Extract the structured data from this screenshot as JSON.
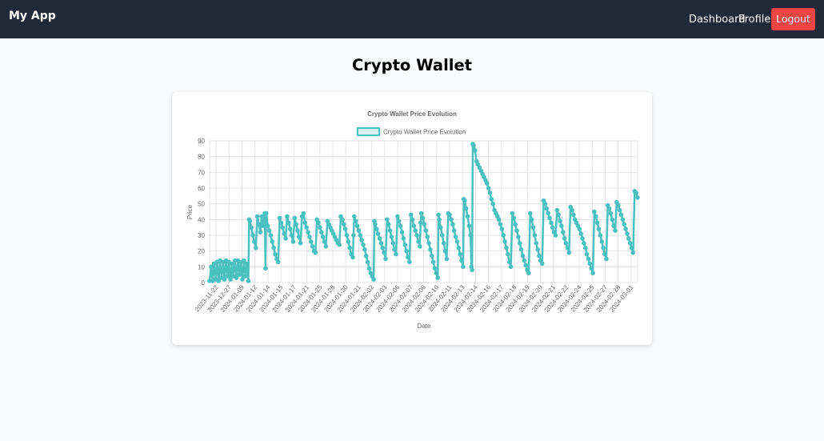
{
  "navbar": {
    "brand": "My App",
    "links": [
      "Dashboard",
      "Profile"
    ],
    "logout_label": "Logout"
  },
  "page": {
    "title": "Crypto Wallet"
  },
  "colors": {
    "navbar_bg": "#1f2937",
    "logout_bg": "#ef4444",
    "series": "#4bc0c0"
  },
  "chart_data": {
    "type": "line",
    "title": "Crypto Wallet Price Evolution",
    "xlabel": "Date",
    "ylabel": "Price",
    "ylim": [
      0,
      90
    ],
    "yticks": [
      0,
      10,
      20,
      30,
      40,
      50,
      60,
      70,
      80,
      90
    ],
    "grid": true,
    "legend": "top",
    "x_tick_labels": [
      "2023-11-22",
      "2023-12-27",
      "2024-01-09",
      "2024-01-12",
      "2024-01-14",
      "2024-01-15",
      "2024-01-17",
      "2024-01-21",
      "2024-01-25",
      "2024-01-28",
      "2024-01-30",
      "2024-01-31",
      "2024-02-02",
      "2024-02-03",
      "2024-02-06",
      "2024-02-07",
      "2024-02-08",
      "2024-02-10",
      "2024-02-11",
      "2024-02-13",
      "2024-02-14",
      "2024-02-16",
      "2024-02-17",
      "2024-02-18",
      "2024-02-19",
      "2024-02-20",
      "2024-02-21",
      "2024-02-22",
      "2024-02-24",
      "2024-02-25",
      "2024-02-27",
      "2024-02-28",
      "2024-03-01"
    ],
    "series": [
      {
        "name": "Crypto Wallet Price Evolution",
        "points": [
          [
            0.0,
            1
          ],
          [
            1.0,
            10
          ],
          [
            2.0,
            1
          ],
          [
            3.0,
            12
          ],
          [
            4.0,
            2
          ],
          [
            5.0,
            13
          ],
          [
            6.0,
            1
          ],
          [
            7.0,
            14
          ],
          [
            8.0,
            3
          ],
          [
            9.0,
            13
          ],
          [
            10.0,
            2
          ],
          [
            11.0,
            14
          ],
          [
            12.0,
            4
          ],
          [
            13.0,
            13
          ],
          [
            14.0,
            2
          ],
          [
            15.0,
            12
          ],
          [
            16.0,
            4
          ],
          [
            17.0,
            14
          ],
          [
            18.0,
            3
          ],
          [
            19.0,
            14
          ],
          [
            20.0,
            5
          ],
          [
            21.0,
            13
          ],
          [
            22.0,
            2
          ],
          [
            23.0,
            14
          ],
          [
            24.0,
            4
          ],
          [
            25.0,
            12
          ],
          [
            26.0,
            1
          ],
          [
            26.5,
            40
          ],
          [
            27.0,
            39
          ],
          [
            28.0,
            35
          ],
          [
            29.0,
            30
          ],
          [
            30.0,
            26
          ],
          [
            31.0,
            22
          ],
          [
            32.0,
            42
          ],
          [
            33.0,
            37
          ],
          [
            34.0,
            32
          ],
          [
            35.0,
            42
          ],
          [
            36.0,
            36
          ],
          [
            37.0,
            44
          ],
          [
            37.5,
            9
          ],
          [
            38.0,
            44
          ],
          [
            39.0,
            36
          ],
          [
            40.0,
            33
          ],
          [
            41.0,
            30
          ],
          [
            42.0,
            26
          ],
          [
            43.0,
            22
          ],
          [
            44.0,
            18
          ],
          [
            45.0,
            15
          ],
          [
            46.0,
            13
          ],
          [
            47.0,
            41
          ],
          [
            48.0,
            38
          ],
          [
            49.0,
            35
          ],
          [
            50.0,
            31
          ],
          [
            51.0,
            28
          ],
          [
            52.0,
            42
          ],
          [
            53.0,
            38
          ],
          [
            54.0,
            34
          ],
          [
            55.0,
            30
          ],
          [
            56.0,
            26
          ],
          [
            57.0,
            41
          ],
          [
            58.0,
            37
          ],
          [
            59.0,
            33
          ],
          [
            60.0,
            29
          ],
          [
            61.0,
            25
          ],
          [
            62.0,
            42
          ],
          [
            63.0,
            44
          ],
          [
            64.0,
            38
          ],
          [
            65.0,
            35
          ],
          [
            66.0,
            32
          ],
          [
            67.0,
            29
          ],
          [
            68.0,
            26
          ],
          [
            69.0,
            23
          ],
          [
            70.0,
            20
          ],
          [
            71.0,
            19
          ],
          [
            72.0,
            40
          ],
          [
            73.0,
            38
          ],
          [
            74.0,
            35
          ],
          [
            75.0,
            32
          ],
          [
            76.0,
            29
          ],
          [
            77.0,
            26
          ],
          [
            78.0,
            23
          ],
          [
            79.0,
            39
          ],
          [
            80.0,
            37
          ],
          [
            81.0,
            35
          ],
          [
            82.0,
            33
          ],
          [
            83.0,
            31
          ],
          [
            84.0,
            29
          ],
          [
            85.0,
            27
          ],
          [
            86.0,
            25
          ],
          [
            87.0,
            24
          ],
          [
            88.0,
            42
          ],
          [
            89.0,
            40
          ],
          [
            90.0,
            37
          ],
          [
            91.0,
            34
          ],
          [
            92.0,
            30
          ],
          [
            93.0,
            26
          ],
          [
            94.0,
            22
          ],
          [
            95.0,
            18
          ],
          [
            96.0,
            16
          ],
          [
            96.5,
            30
          ],
          [
            97.0,
            42
          ],
          [
            98.0,
            39
          ],
          [
            99.0,
            36
          ],
          [
            100.0,
            33
          ],
          [
            101.0,
            30
          ],
          [
            102.0,
            27
          ],
          [
            103.0,
            24
          ],
          [
            104.0,
            21
          ],
          [
            105.0,
            17
          ],
          [
            106.0,
            13
          ],
          [
            107.0,
            9
          ],
          [
            108.0,
            6
          ],
          [
            109.0,
            4
          ],
          [
            110.0,
            2
          ],
          [
            110.5,
            39
          ],
          [
            111.0,
            37
          ],
          [
            112.0,
            34
          ],
          [
            113.0,
            31
          ],
          [
            114.0,
            28
          ],
          [
            115.0,
            25
          ],
          [
            116.0,
            22
          ],
          [
            117.0,
            19
          ],
          [
            118.0,
            15
          ],
          [
            119.0,
            40
          ],
          [
            120.0,
            37
          ],
          [
            121.0,
            33
          ],
          [
            122.0,
            29
          ],
          [
            123.0,
            25
          ],
          [
            124.0,
            21
          ],
          [
            125.0,
            18
          ],
          [
            126.0,
            42
          ],
          [
            127.0,
            39
          ],
          [
            128.0,
            36
          ],
          [
            129.0,
            32
          ],
          [
            130.0,
            28
          ],
          [
            131.0,
            24
          ],
          [
            132.0,
            20
          ],
          [
            133.0,
            16
          ],
          [
            134.0,
            13
          ],
          [
            135.0,
            43
          ],
          [
            136.0,
            40
          ],
          [
            137.0,
            36
          ],
          [
            138.0,
            33
          ],
          [
            139.0,
            30
          ],
          [
            140.0,
            26
          ],
          [
            141.0,
            23
          ],
          [
            141.5,
            38
          ],
          [
            142.0,
            44
          ],
          [
            143.0,
            41
          ],
          [
            144.0,
            37
          ],
          [
            145.0,
            33
          ],
          [
            146.0,
            29
          ],
          [
            147.0,
            25
          ],
          [
            148.0,
            21
          ],
          [
            149.0,
            17
          ],
          [
            150.0,
            13
          ],
          [
            151.0,
            9
          ],
          [
            152.0,
            6
          ],
          [
            153.0,
            3
          ],
          [
            153.5,
            43
          ],
          [
            154.0,
            40
          ],
          [
            155.0,
            35
          ],
          [
            156.0,
            30
          ],
          [
            157.0,
            25
          ],
          [
            158.0,
            20
          ],
          [
            159.0,
            15
          ],
          [
            160.0,
            44
          ],
          [
            161.0,
            43
          ],
          [
            162.0,
            40
          ],
          [
            163.0,
            37
          ],
          [
            164.0,
            33
          ],
          [
            165.0,
            29
          ],
          [
            166.0,
            26
          ],
          [
            167.0,
            22
          ],
          [
            168.0,
            18
          ],
          [
            169.0,
            14
          ],
          [
            170.0,
            10
          ],
          [
            170.5,
            53
          ],
          [
            171.0,
            52
          ],
          [
            172.0,
            47
          ],
          [
            173.0,
            42
          ],
          [
            174.0,
            36
          ],
          [
            175.0,
            30
          ],
          [
            175.5,
            10
          ],
          [
            176.0,
            8
          ],
          [
            176.5,
            88
          ],
          [
            177.0,
            87
          ],
          [
            178.0,
            84
          ],
          [
            179.0,
            77
          ],
          [
            180.0,
            75
          ],
          [
            181.0,
            73
          ],
          [
            182.0,
            71
          ],
          [
            183.0,
            69
          ],
          [
            184.0,
            67
          ],
          [
            185.0,
            65
          ],
          [
            186.0,
            63
          ],
          [
            187.0,
            60
          ],
          [
            188.0,
            57
          ],
          [
            189.0,
            53
          ],
          [
            190.0,
            50
          ],
          [
            191.0,
            46
          ],
          [
            192.0,
            44
          ],
          [
            193.0,
            42
          ],
          [
            194.0,
            40
          ],
          [
            195.0,
            37
          ],
          [
            196.0,
            34
          ],
          [
            197.0,
            30
          ],
          [
            198.0,
            26
          ],
          [
            199.0,
            22
          ],
          [
            200.0,
            18
          ],
          [
            201.0,
            13
          ],
          [
            202.0,
            10
          ],
          [
            203.0,
            44
          ],
          [
            204.0,
            41
          ],
          [
            205.0,
            37
          ],
          [
            206.0,
            33
          ],
          [
            207.0,
            29
          ],
          [
            208.0,
            25
          ],
          [
            209.0,
            21
          ],
          [
            210.0,
            17
          ],
          [
            211.0,
            14
          ],
          [
            212.0,
            11
          ],
          [
            213.0,
            8
          ],
          [
            214.0,
            6
          ],
          [
            215.0,
            44
          ],
          [
            216.0,
            40
          ],
          [
            217.0,
            35
          ],
          [
            218.0,
            30
          ],
          [
            219.0,
            25
          ],
          [
            220.0,
            21
          ],
          [
            221.0,
            17
          ],
          [
            222.0,
            14
          ],
          [
            223.0,
            12
          ],
          [
            224.0,
            52
          ],
          [
            225.0,
            50
          ],
          [
            226.0,
            47
          ],
          [
            227.0,
            44
          ],
          [
            228.0,
            41
          ],
          [
            229.0,
            38
          ],
          [
            230.0,
            35
          ],
          [
            231.0,
            32
          ],
          [
            232.0,
            30
          ],
          [
            233.0,
            46
          ],
          [
            234.0,
            43
          ],
          [
            235.0,
            39
          ],
          [
            236.0,
            36
          ],
          [
            237.0,
            32
          ],
          [
            238.0,
            28
          ],
          [
            239.0,
            25
          ],
          [
            240.0,
            22
          ],
          [
            241.0,
            19
          ],
          [
            242.0,
            48
          ],
          [
            243.0,
            46
          ],
          [
            244.0,
            43
          ],
          [
            245.0,
            40
          ],
          [
            246.0,
            38
          ],
          [
            247.0,
            36
          ],
          [
            248.0,
            34
          ],
          [
            249.0,
            31
          ],
          [
            250.0,
            28
          ],
          [
            251.0,
            25
          ],
          [
            252.0,
            22
          ],
          [
            253.0,
            18
          ],
          [
            254.0,
            15
          ],
          [
            255.0,
            12
          ],
          [
            256.0,
            9
          ],
          [
            257.0,
            6
          ],
          [
            258.0,
            45
          ],
          [
            259.0,
            42
          ],
          [
            260.0,
            38
          ],
          [
            261.0,
            34
          ],
          [
            262.0,
            30
          ],
          [
            263.0,
            26
          ],
          [
            264.0,
            22
          ],
          [
            265.0,
            18
          ],
          [
            266.0,
            15
          ],
          [
            267.0,
            49
          ],
          [
            268.0,
            47
          ],
          [
            269.0,
            44
          ],
          [
            270.0,
            40
          ],
          [
            271.0,
            36
          ],
          [
            272.0,
            33
          ],
          [
            273.0,
            51
          ],
          [
            274.0,
            49
          ],
          [
            275.0,
            46
          ],
          [
            276.0,
            43
          ],
          [
            277.0,
            40
          ],
          [
            278.0,
            37
          ],
          [
            279.0,
            34
          ],
          [
            280.0,
            31
          ],
          [
            281.0,
            28
          ],
          [
            282.0,
            25
          ],
          [
            283.0,
            22
          ],
          [
            284.0,
            19
          ],
          [
            285.0,
            58
          ],
          [
            286.0,
            57
          ],
          [
            287.0,
            54
          ]
        ]
      }
    ]
  }
}
